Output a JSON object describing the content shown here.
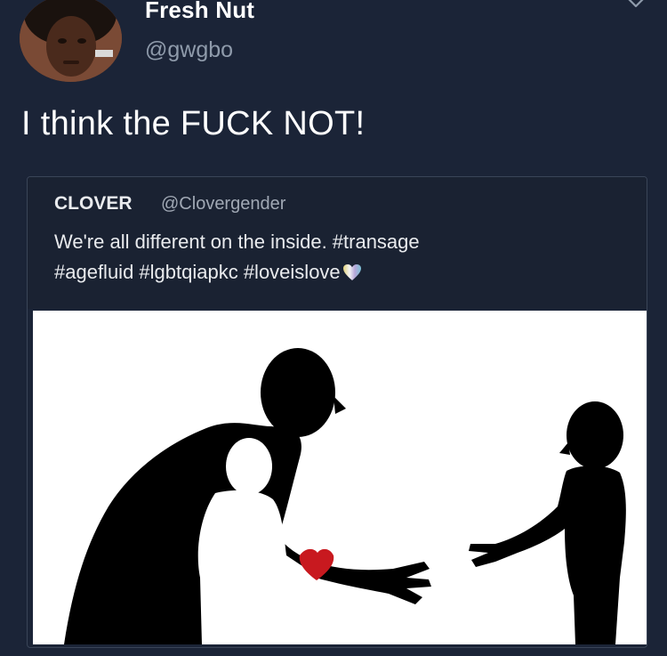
{
  "tweet": {
    "author": {
      "name": "Fresh Nut",
      "handle": "@gwgbo"
    },
    "text": "I think the FUCK NOT!"
  },
  "quoted_tweet": {
    "author": {
      "name": "CLOVER",
      "handle": "@Clovergender"
    },
    "text_line1": "We're all different on the inside. #transage",
    "text_line2": "#agefluid #lgbtqiapkc #loveislove"
  },
  "icons": {
    "menu": "chevron-down-icon",
    "heart": "heart-icon"
  },
  "colors": {
    "background": "#1b2437",
    "handle": "#8f9bab",
    "quote_border": "#3a4558"
  }
}
